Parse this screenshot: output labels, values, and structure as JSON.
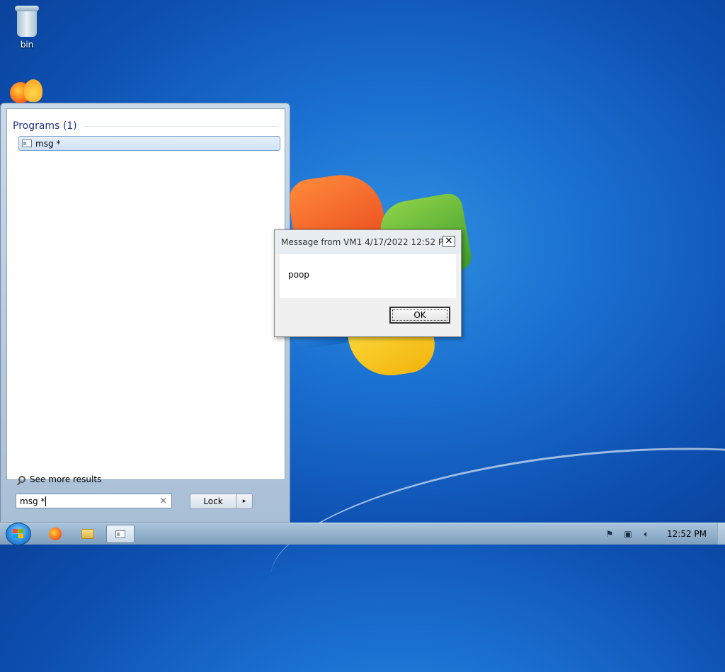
{
  "desktop": {
    "icons": [
      {
        "label": "bin",
        "icon": "recycle-bin-icon"
      },
      {
        "label": "",
        "icon": "firefox-icon"
      }
    ]
  },
  "start_menu": {
    "section_title": "Programs (1)",
    "result_label": "msg *",
    "result_icon": "console-window-icon",
    "see_more": "See more results",
    "search_value": "msg *",
    "clear_glyph": "×",
    "lock_label": "Lock",
    "lock_arrow": "▸"
  },
  "dialog": {
    "title": "Message from VM1 4/17/2022 12:52 PM",
    "close_glyph": "✕",
    "message": "poop",
    "ok_label": "OK"
  },
  "taskbar": {
    "items": [
      {
        "icon": "firefox-icon"
      },
      {
        "icon": "folder-icon"
      },
      {
        "icon": "console-window-icon",
        "active": true
      }
    ],
    "tray_icons": [
      "action-center-flag-icon",
      "network-icon",
      "volume-icon"
    ],
    "clock": "12:52 PM"
  },
  "colors": {
    "desktop_blue": "#1a6fd0",
    "section_title": "#1e3287",
    "selection_border": "#7da2ce"
  }
}
